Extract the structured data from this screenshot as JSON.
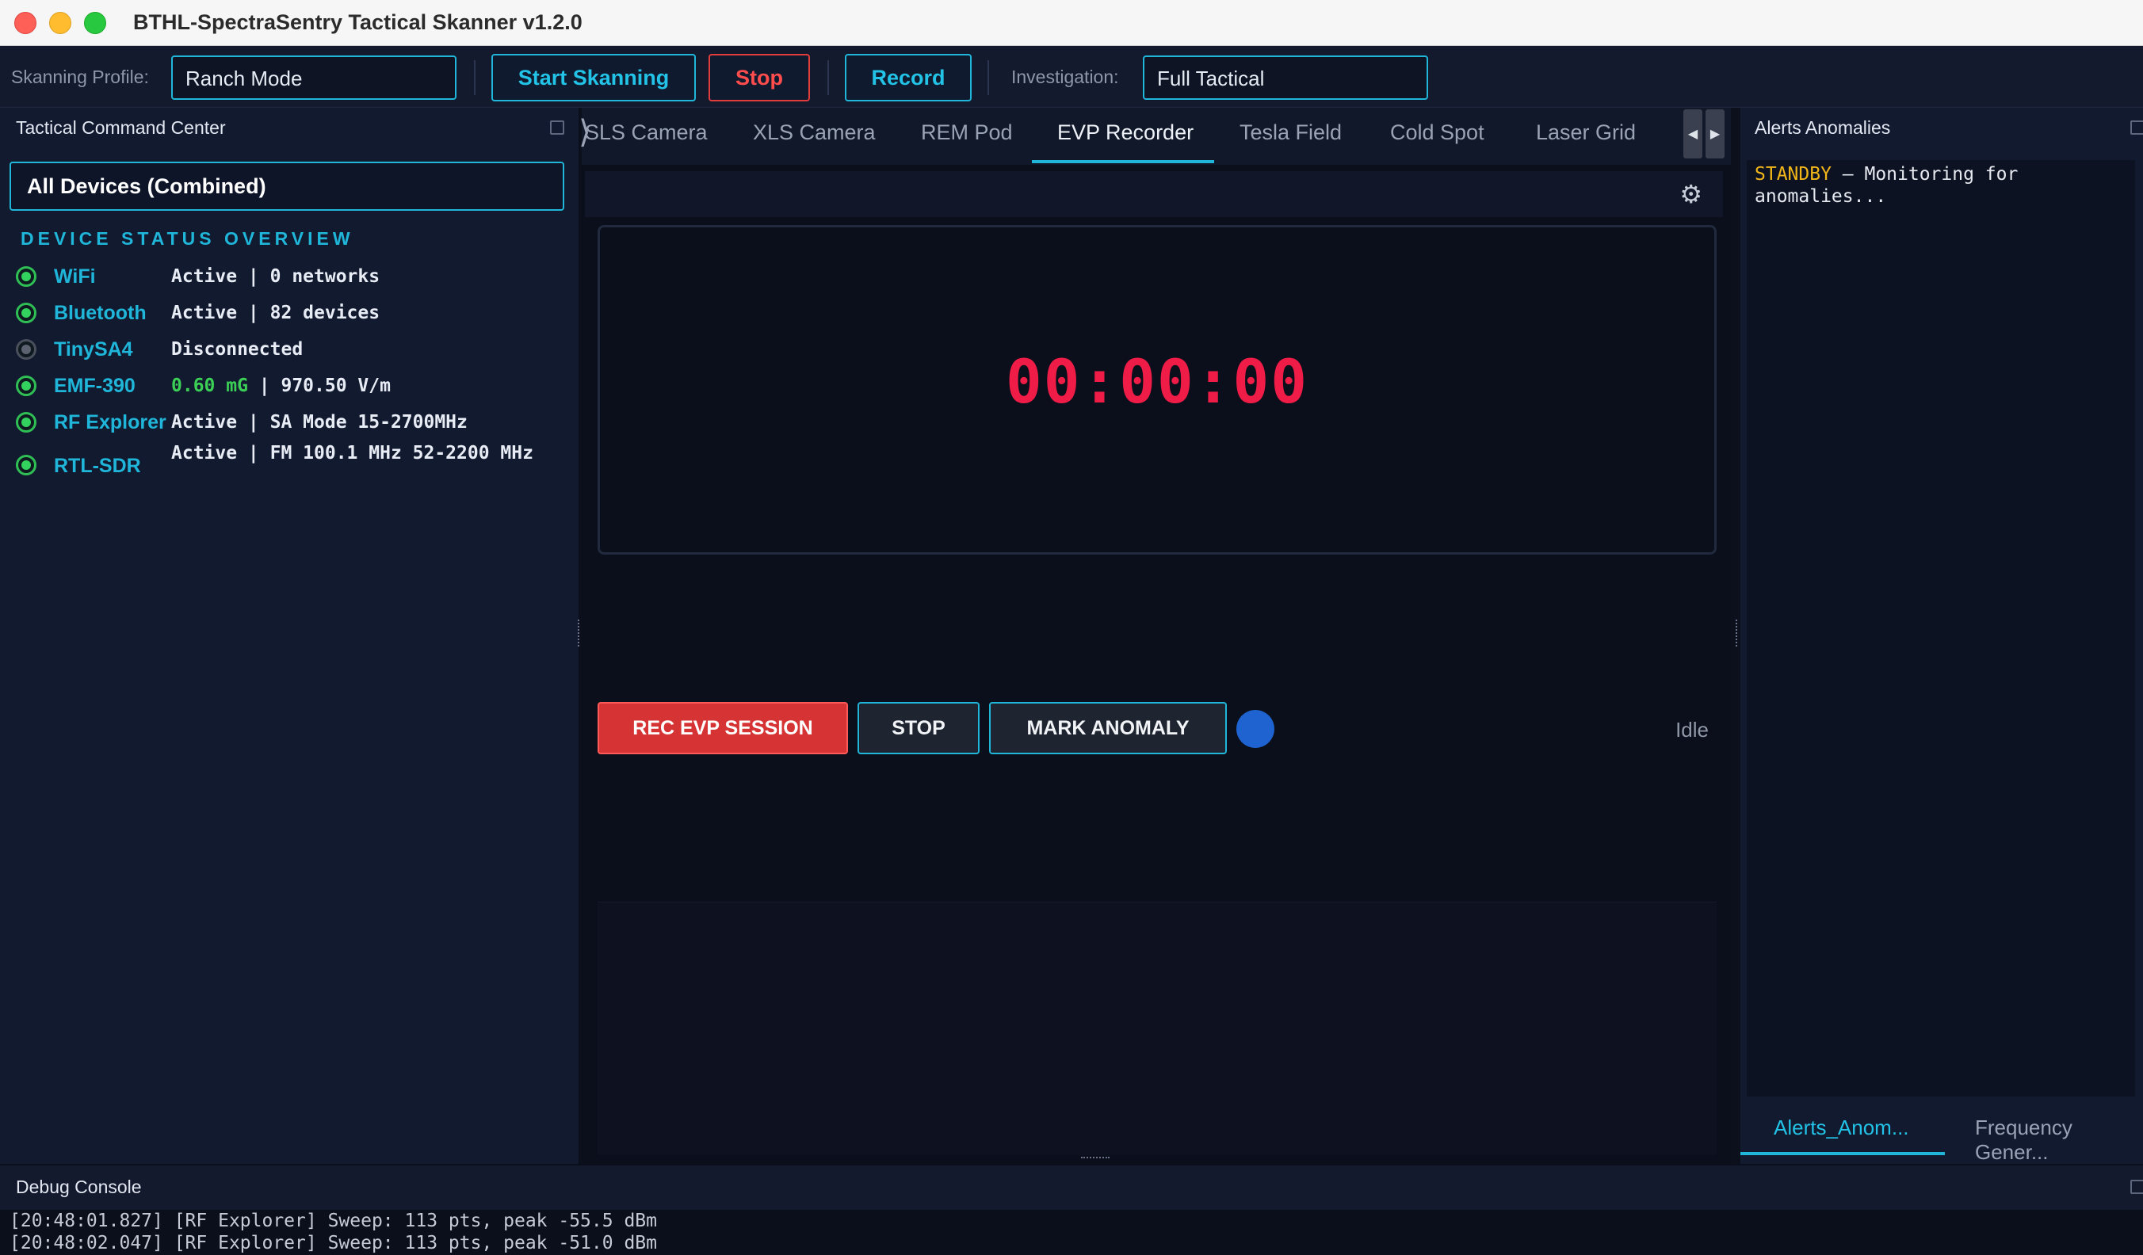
{
  "window": {
    "title": "BTHL-SpectraSentry Tactical Skanner v1.2.0"
  },
  "toolbar": {
    "profile_label": "Skanning Profile:",
    "profile_value": "Ranch Mode",
    "start_label": "Start Skanning",
    "stop_label": "Stop",
    "record_label": "Record",
    "investigation_label": "Investigation:",
    "investigation_value": "Full Tactical"
  },
  "left_panel": {
    "title": "Tactical Command Center",
    "device_select": "All Devices (Combined)",
    "overview_title": "DEVICE STATUS OVERVIEW",
    "devices": [
      {
        "name": "WiFi",
        "status": "Active | 0 networks",
        "online": true
      },
      {
        "name": "Bluetooth",
        "status": "Active | 82 devices",
        "online": true
      },
      {
        "name": "TinySA4",
        "status": "Disconnected",
        "online": false
      },
      {
        "name": "EMF-390",
        "status_green": "0.60 mG",
        "status": " | 970.50 V/m",
        "online": true
      },
      {
        "name": "RF Explorer",
        "status": "Active | SA Mode  15-2700MHz",
        "online": true
      },
      {
        "name": "RTL-SDR",
        "status": "Active | FM 100.1 MHz  52-2200 MHz",
        "online": true
      }
    ]
  },
  "tabs": [
    {
      "label": "SLS Camera"
    },
    {
      "label": "XLS Camera"
    },
    {
      "label": "REM Pod"
    },
    {
      "label": "EVP Recorder",
      "active": true
    },
    {
      "label": "Tesla Field"
    },
    {
      "label": "Cold Spot"
    },
    {
      "label": "Laser Grid"
    }
  ],
  "evp": {
    "timer": "00:00:00",
    "rec_label": "REC EVP SESSION",
    "stop_label": "STOP",
    "mark_label": "MARK ANOMALY",
    "status": "Idle",
    "indicator_color": "#1e63cf"
  },
  "right_panel": {
    "title": "Alerts  Anomalies",
    "alert_prefix": "STANDBY",
    "alert_text": " – Monitoring for anomalies...",
    "tabs": [
      {
        "label": "Alerts_Anom...",
        "active": true
      },
      {
        "label": "Frequency Gener..."
      }
    ]
  },
  "debug": {
    "title": "Debug Console",
    "lines": [
      "[20:48:01.827] [RF Explorer] Sweep: 113 pts, peak -55.5 dBm",
      "[20:48:02.047] [RF Explorer] Sweep: 113 pts, peak -51.0 dBm"
    ]
  },
  "colors": {
    "accent": "#1fb6d9",
    "danger": "#e23d3d",
    "timer": "#ee1c46",
    "online": "#33d15e",
    "standby": "#f2b619"
  }
}
